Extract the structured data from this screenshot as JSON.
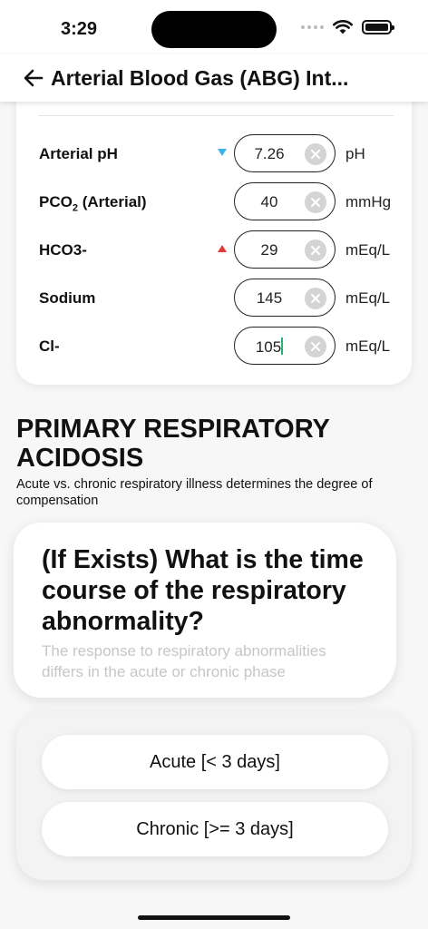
{
  "status_bar": {
    "time": "3:29"
  },
  "header": {
    "title": "Arterial Blood Gas (ABG) Int..."
  },
  "inputs": [
    {
      "label": "Arterial pH",
      "value": "7.26",
      "unit": "pH",
      "indicator": "down"
    },
    {
      "label": "PCO",
      "label_sub": "2",
      "label_suffix": " (Arterial)",
      "value": "40",
      "unit": "mmHg",
      "indicator": "none"
    },
    {
      "label": "HCO3-",
      "value": "29",
      "unit": "mEq/L",
      "indicator": "up"
    },
    {
      "label": "Sodium",
      "value": "145",
      "unit": "mEq/L",
      "indicator": "none"
    },
    {
      "label": "Cl-",
      "value": "105",
      "unit": "mEq/L",
      "indicator": "none",
      "focused": true
    }
  ],
  "result": {
    "title": "PRIMARY RESPIRATORY ACIDOSIS",
    "subtitle": "Acute vs. chronic respiratory illness determines the degree of compensation"
  },
  "question": {
    "title": "(If Exists) What is the time course of the respiratory abnormality?",
    "hint": "The response to respiratory abnormalities differs in the acute or chronic phase"
  },
  "options": [
    {
      "label": "Acute [< 3 days]"
    },
    {
      "label": "Chronic [>= 3 days]"
    }
  ],
  "colors": {
    "indicator_low": "#3ab3e6",
    "indicator_high": "#e53935",
    "caret": "#22b573",
    "hint_text": "#c6c6c6"
  }
}
